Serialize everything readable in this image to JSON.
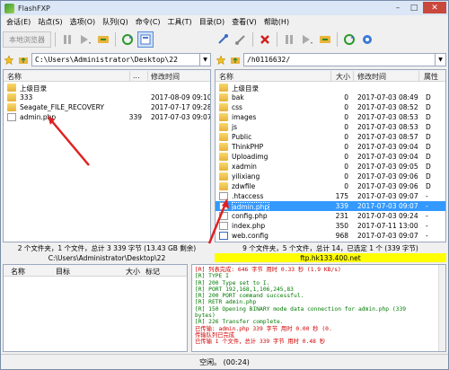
{
  "app": {
    "title": "FlashFXP",
    "accent": "#3399ff"
  },
  "menu": [
    "会话(E)",
    "站点(S)",
    "选项(O)",
    "队列(Q)",
    "命令(C)",
    "工具(T)",
    "目录(D)",
    "查看(V)",
    "帮助(H)"
  ],
  "toolbar_left": {
    "local_browser_label": "本地浏览器"
  },
  "local": {
    "path": "C:\\Users\\Administrator\\Desktop\\22",
    "headers": {
      "name": "名称",
      "dots": "...",
      "date": "修改时间"
    },
    "rows": [
      {
        "name": "上级目录",
        "size": "",
        "date": "",
        "icon": "upfolder"
      },
      {
        "name": "333",
        "size": "",
        "date": "2017-08-09 09:10",
        "icon": "folder"
      },
      {
        "name": "Seagate_FILE_RECOVERY",
        "size": "",
        "date": "2017-07-17 09:28",
        "icon": "folder"
      },
      {
        "name": "admin.php",
        "size": "339",
        "date": "2017-07-03 09:07",
        "icon": "file"
      }
    ],
    "status1": "2 个文件夹，1 个文件，总计 3 339 字节 (13.43 GB 剩余)",
    "status2": "C:\\Users\\Administrator\\Desktop\\22"
  },
  "remote": {
    "path": "/h0116632/",
    "headers": {
      "name": "名称",
      "size": "大小",
      "date": "修改时间",
      "attr": "属性"
    },
    "rows": [
      {
        "name": "上级目录",
        "size": "",
        "date": "",
        "attr": "",
        "icon": "upfolder"
      },
      {
        "name": "bak",
        "size": "0",
        "date": "2017-07-03 08:49",
        "attr": "D",
        "icon": "folder"
      },
      {
        "name": "css",
        "size": "0",
        "date": "2017-07-03 08:52",
        "attr": "D",
        "icon": "folder"
      },
      {
        "name": "images",
        "size": "0",
        "date": "2017-07-03 08:53",
        "attr": "D",
        "icon": "folder"
      },
      {
        "name": "js",
        "size": "0",
        "date": "2017-07-03 08:53",
        "attr": "D",
        "icon": "folder"
      },
      {
        "name": "Public",
        "size": "0",
        "date": "2017-07-03 08:57",
        "attr": "D",
        "icon": "folder"
      },
      {
        "name": "ThinkPHP",
        "size": "0",
        "date": "2017-07-03 09:04",
        "attr": "D",
        "icon": "folder"
      },
      {
        "name": "Uploadimg",
        "size": "0",
        "date": "2017-07-03 09:04",
        "attr": "D",
        "icon": "folder"
      },
      {
        "name": "xadmin",
        "size": "0",
        "date": "2017-07-03 09:05",
        "attr": "D",
        "icon": "folder"
      },
      {
        "name": "yilixiang",
        "size": "0",
        "date": "2017-07-03 09:06",
        "attr": "D",
        "icon": "folder"
      },
      {
        "name": "zdwfile",
        "size": "0",
        "date": "2017-07-03 09:06",
        "attr": "D",
        "icon": "folder"
      },
      {
        "name": ".htaccess",
        "size": "175",
        "date": "2017-07-03 09:07",
        "attr": "-",
        "icon": "file"
      },
      {
        "name": "admin.php",
        "size": "339",
        "date": "2017-07-03 09:07",
        "attr": "-",
        "icon": "file",
        "selected": true
      },
      {
        "name": "config.php",
        "size": "231",
        "date": "2017-07-03 09:24",
        "attr": "-",
        "icon": "file"
      },
      {
        "name": "index.php",
        "size": "350",
        "date": "2017-07-11 13:00",
        "attr": "-",
        "icon": "file"
      },
      {
        "name": "web.config",
        "size": "968",
        "date": "2017-07-03 09:07",
        "attr": "-",
        "icon": "fileblue"
      }
    ],
    "status1": "9 个文件夹，5 个文件，总计 14，已选定 1 个 (339 字节)",
    "status2": "ftp.hk133.400.net"
  },
  "queue": {
    "headers": {
      "name": "名称",
      "target": "目标",
      "size": "大小",
      "mark": "标记"
    }
  },
  "log": [
    {
      "text": "[R] 列表完成: 646 字节 用时 0.33 秒 (1.9 KB/s)",
      "color": "red"
    },
    {
      "text": "[R] TYPE I",
      "color": "green"
    },
    {
      "text": "[R] 200 Type set to I.",
      "color": "green"
    },
    {
      "text": "[R] PORT 192,168,1,106,245,83",
      "color": "green"
    },
    {
      "text": "[R] 200 PORT command successful.",
      "color": "green"
    },
    {
      "text": "[R] RETR admin.php",
      "color": "green"
    },
    {
      "text": "[R] 150 Opening BINARY mode data connection for admin.php (339",
      "color": "green"
    },
    {
      "text": "bytes)",
      "color": "green"
    },
    {
      "text": "[R] 226 Transfer complete.",
      "color": "green"
    },
    {
      "text": "已传输: admin.php 339 字节 用时 0.00 秒 (0.",
      "color": "red"
    },
    {
      "text": "传输队列已完成",
      "color": "red"
    },
    {
      "text": "已传输 1 个文件，总计 339 字节 用时 0.48 秒",
      "color": "red"
    }
  ],
  "bottom": {
    "status": "空闲。 (00:24)"
  }
}
